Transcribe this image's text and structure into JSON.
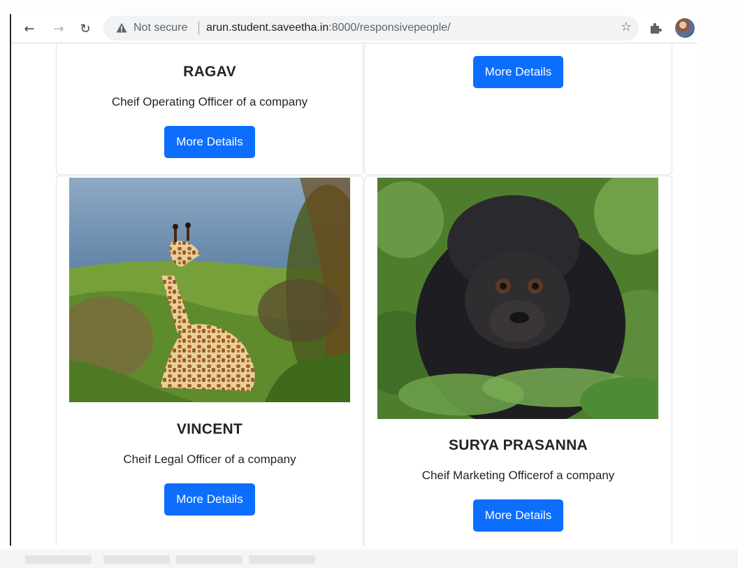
{
  "browser": {
    "not_secure_label": "Not secure",
    "url_host": "arun.student.saveetha.in",
    "url_path": ":8000/responsivepeople/",
    "icons": [
      "back-arrow-icon",
      "forward-arrow-icon",
      "reload-icon",
      "warning-icon",
      "star-icon",
      "extensions-icon",
      "profile-avatar"
    ]
  },
  "cards": [
    {
      "name": "RAGAV",
      "role": "Cheif Operating Officer of a company",
      "button": "More Details"
    },
    {
      "name": "",
      "role": "",
      "button": "More Details"
    },
    {
      "name": "VINCENT",
      "role": "Cheif Legal Officer of a company",
      "button": "More Details",
      "image": "giraffe-photo"
    },
    {
      "name": "SURYA PRASANNA",
      "role": "Cheif Marketing Officerof a company",
      "button": "More Details",
      "image": "gorilla-photo"
    }
  ],
  "colors": {
    "button": "#0d6efd",
    "button_text": "#ffffff",
    "omnibox": "#f1f3f4"
  }
}
